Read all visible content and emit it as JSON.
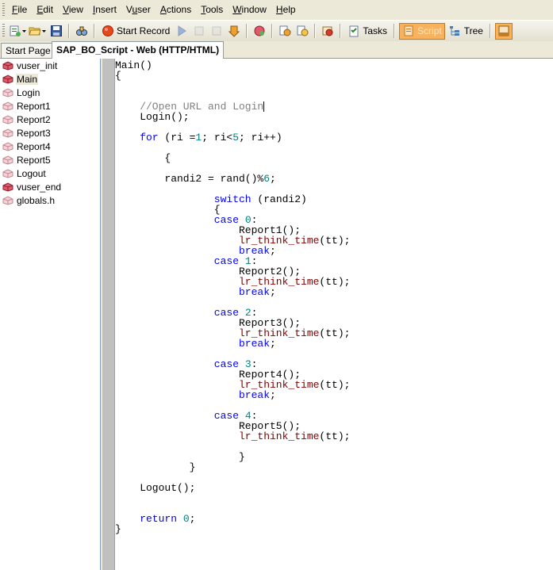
{
  "menu": {
    "items": [
      {
        "label": "File",
        "key": "F",
        "rest": "ile"
      },
      {
        "label": "Edit",
        "key": "E",
        "rest": "dit"
      },
      {
        "label": "View",
        "key": "V",
        "rest": "iew"
      },
      {
        "label": "Insert",
        "key": "I",
        "rest": "nsert"
      },
      {
        "label": "Vuser",
        "key": "u",
        "pre": "V",
        "rest": "ser"
      },
      {
        "label": "Actions",
        "key": "A",
        "rest": "ctions"
      },
      {
        "label": "Tools",
        "key": "T",
        "rest": "ools"
      },
      {
        "label": "Window",
        "key": "W",
        "rest": "indow"
      },
      {
        "label": "Help",
        "key": "H",
        "rest": "elp"
      }
    ]
  },
  "toolbar": {
    "start_record_label": "Start Record",
    "tasks_label": "Tasks",
    "script_label": "Script",
    "tree_label": "Tree",
    "colors": {
      "record": "#e8461c",
      "play": "#3a6fd8",
      "script_active": "#f8b25d"
    }
  },
  "tabs": {
    "start_page": "Start Page",
    "script": "SAP_BO_Script - Web (HTTP/HTML)"
  },
  "tree": {
    "items": [
      {
        "label": "vuser_init",
        "kind": "special"
      },
      {
        "label": "Main",
        "kind": "special",
        "selected": true
      },
      {
        "label": "Login",
        "kind": "action"
      },
      {
        "label": "Report1",
        "kind": "action"
      },
      {
        "label": "Report2",
        "kind": "action"
      },
      {
        "label": "Report3",
        "kind": "action"
      },
      {
        "label": "Report4",
        "kind": "action"
      },
      {
        "label": "Report5",
        "kind": "action"
      },
      {
        "label": "Logout",
        "kind": "action"
      },
      {
        "label": "vuser_end",
        "kind": "special"
      },
      {
        "label": "globals.h",
        "kind": "action"
      }
    ]
  },
  "editor": {
    "colors": {
      "keyword": "#0000ff",
      "number": "#008080",
      "comment": "#808080",
      "function": "#800000",
      "text": "#000000"
    },
    "lines": [
      {
        "row": 0,
        "indent": 0,
        "tokens": [
          [
            "Main()",
            "def"
          ]
        ]
      },
      {
        "row": 1,
        "indent": 0,
        "tokens": [
          [
            "{",
            "def"
          ]
        ]
      },
      {
        "row": 4,
        "indent": 4,
        "tokens": [
          [
            "//Open URL and Login",
            "cmt"
          ]
        ],
        "caret": true
      },
      {
        "row": 5,
        "indent": 4,
        "tokens": [
          [
            "Login();",
            "def"
          ]
        ]
      },
      {
        "row": 7,
        "indent": 4,
        "tokens": [
          [
            "for",
            "kw"
          ],
          [
            " (ri =",
            "def"
          ],
          [
            "1",
            "num"
          ],
          [
            "; ri<",
            "def"
          ],
          [
            "5",
            "num"
          ],
          [
            "; ri++)",
            "def"
          ]
        ]
      },
      {
        "row": 9,
        "indent": 8,
        "tokens": [
          [
            "{",
            "def"
          ]
        ]
      },
      {
        "row": 11,
        "indent": 8,
        "tokens": [
          [
            "randi2 = rand()%",
            "def"
          ],
          [
            "6",
            "num"
          ],
          [
            ";",
            "def"
          ]
        ]
      },
      {
        "row": 13,
        "indent": 16,
        "tokens": [
          [
            "switch",
            "kw"
          ],
          [
            " (randi2)",
            "def"
          ]
        ]
      },
      {
        "row": 14,
        "indent": 16,
        "tokens": [
          [
            "{",
            "def"
          ]
        ]
      },
      {
        "row": 15,
        "indent": 16,
        "tokens": [
          [
            "case",
            "kw"
          ],
          [
            " ",
            "def"
          ],
          [
            "0",
            "num"
          ],
          [
            ":",
            "def"
          ]
        ]
      },
      {
        "row": 16,
        "indent": 20,
        "tokens": [
          [
            "Report1();",
            "def"
          ]
        ]
      },
      {
        "row": 17,
        "indent": 20,
        "tokens": [
          [
            "lr_think_time",
            "fn"
          ],
          [
            "(tt);",
            "def"
          ]
        ]
      },
      {
        "row": 18,
        "indent": 20,
        "tokens": [
          [
            "break",
            "kw"
          ],
          [
            ";",
            "def"
          ]
        ]
      },
      {
        "row": 19,
        "indent": 16,
        "tokens": [
          [
            "case",
            "kw"
          ],
          [
            " ",
            "def"
          ],
          [
            "1",
            "num"
          ],
          [
            ":",
            "def"
          ]
        ]
      },
      {
        "row": 20,
        "indent": 20,
        "tokens": [
          [
            "Report2();",
            "def"
          ]
        ]
      },
      {
        "row": 21,
        "indent": 20,
        "tokens": [
          [
            "lr_think_time",
            "fn"
          ],
          [
            "(tt);",
            "def"
          ]
        ]
      },
      {
        "row": 22,
        "indent": 20,
        "tokens": [
          [
            "break",
            "kw"
          ],
          [
            ";",
            "def"
          ]
        ]
      },
      {
        "row": 24,
        "indent": 16,
        "tokens": [
          [
            "case",
            "kw"
          ],
          [
            " ",
            "def"
          ],
          [
            "2",
            "num"
          ],
          [
            ":",
            "def"
          ]
        ]
      },
      {
        "row": 25,
        "indent": 20,
        "tokens": [
          [
            "Report3();",
            "def"
          ]
        ]
      },
      {
        "row": 26,
        "indent": 20,
        "tokens": [
          [
            "lr_think_time",
            "fn"
          ],
          [
            "(tt);",
            "def"
          ]
        ]
      },
      {
        "row": 27,
        "indent": 20,
        "tokens": [
          [
            "break",
            "kw"
          ],
          [
            ";",
            "def"
          ]
        ]
      },
      {
        "row": 29,
        "indent": 16,
        "tokens": [
          [
            "case",
            "kw"
          ],
          [
            " ",
            "def"
          ],
          [
            "3",
            "num"
          ],
          [
            ":",
            "def"
          ]
        ]
      },
      {
        "row": 30,
        "indent": 20,
        "tokens": [
          [
            "Report4();",
            "def"
          ]
        ]
      },
      {
        "row": 31,
        "indent": 20,
        "tokens": [
          [
            "lr_think_time",
            "fn"
          ],
          [
            "(tt);",
            "def"
          ]
        ]
      },
      {
        "row": 32,
        "indent": 20,
        "tokens": [
          [
            "break",
            "kw"
          ],
          [
            ";",
            "def"
          ]
        ]
      },
      {
        "row": 34,
        "indent": 16,
        "tokens": [
          [
            "case",
            "kw"
          ],
          [
            " ",
            "def"
          ],
          [
            "4",
            "num"
          ],
          [
            ":",
            "def"
          ]
        ]
      },
      {
        "row": 35,
        "indent": 20,
        "tokens": [
          [
            "Report5();",
            "def"
          ]
        ]
      },
      {
        "row": 36,
        "indent": 20,
        "tokens": [
          [
            "lr_think_time",
            "fn"
          ],
          [
            "(tt);",
            "def"
          ]
        ]
      },
      {
        "row": 38,
        "indent": 20,
        "tokens": [
          [
            "}",
            "def"
          ]
        ]
      },
      {
        "row": 39,
        "indent": 12,
        "tokens": [
          [
            "}",
            "def"
          ]
        ]
      },
      {
        "row": 41,
        "indent": 4,
        "tokens": [
          [
            "Logout();",
            "def"
          ]
        ]
      },
      {
        "row": 44,
        "indent": 4,
        "tokens": [
          [
            "return",
            "kw"
          ],
          [
            " ",
            "def"
          ],
          [
            "0",
            "num"
          ],
          [
            ";",
            "def"
          ]
        ]
      },
      {
        "row": 45,
        "indent": 0,
        "tokens": [
          [
            "}",
            "def"
          ]
        ]
      }
    ]
  }
}
